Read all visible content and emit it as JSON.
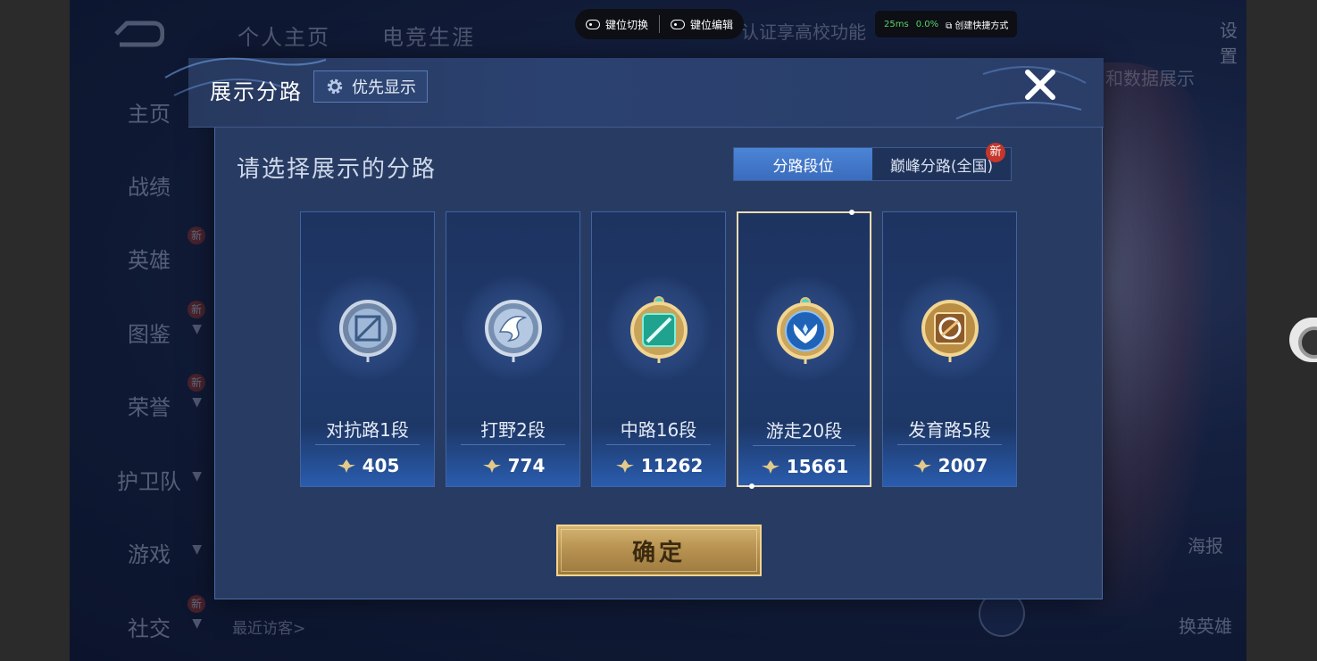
{
  "background": {
    "tabs": [
      "个人主页",
      "电竞生涯"
    ],
    "sidebar": [
      {
        "label": "主页",
        "has_new": false,
        "has_chevron": false
      },
      {
        "label": "战绩",
        "has_new": false,
        "has_chevron": false
      },
      {
        "label": "英雄",
        "has_new": true,
        "has_chevron": false
      },
      {
        "label": "图鉴",
        "has_new": true,
        "has_chevron": true
      },
      {
        "label": "荣誉",
        "has_new": true,
        "has_chevron": true
      },
      {
        "label": "护卫队",
        "has_new": false,
        "has_chevron": true
      },
      {
        "label": "游戏",
        "has_new": false,
        "has_chevron": true
      },
      {
        "label": "社交",
        "has_new": true,
        "has_chevron": true
      }
    ],
    "new_badge": "新",
    "cert_text": "认证享高校功能",
    "data_text": "和数据展示",
    "settings": "设置",
    "recent_visitors": "最近访客>",
    "right_buttons": [
      {
        "label": "海报"
      },
      {
        "label": "换英雄"
      }
    ]
  },
  "toolbar": {
    "switch_label": "键位切换",
    "edit_label": "键位编辑"
  },
  "status": {
    "ping": "25ms",
    "loss": "0.0%",
    "shortcut": "创建快捷方式"
  },
  "dialog": {
    "title": "展示分路",
    "priority_label": "优先显示",
    "subtitle": "请选择展示的分路",
    "segments": [
      {
        "label": "分路段位",
        "active": true,
        "new": false
      },
      {
        "label": "巅峰分路(全国)",
        "active": false,
        "new": true
      }
    ],
    "segment_new": "新",
    "cards": [
      {
        "name": "对抗路1段",
        "score": "405",
        "selected": false,
        "emblem": "sword-shield-emblem"
      },
      {
        "name": "打野2段",
        "score": "774",
        "selected": false,
        "emblem": "dragon-emblem"
      },
      {
        "name": "中路16段",
        "score": "11262",
        "selected": false,
        "emblem": "mid-lane-emblem"
      },
      {
        "name": "游走20段",
        "score": "15661",
        "selected": true,
        "emblem": "wing-emblem"
      },
      {
        "name": "发育路5段",
        "score": "2007",
        "selected": false,
        "emblem": "marksman-emblem"
      }
    ],
    "confirm_label": "确定"
  },
  "colors": {
    "dialog_bg": "#283c63",
    "active_tab": "#4b84d6",
    "gold": "#c9a560",
    "selected_border": "#f0dcb2"
  }
}
